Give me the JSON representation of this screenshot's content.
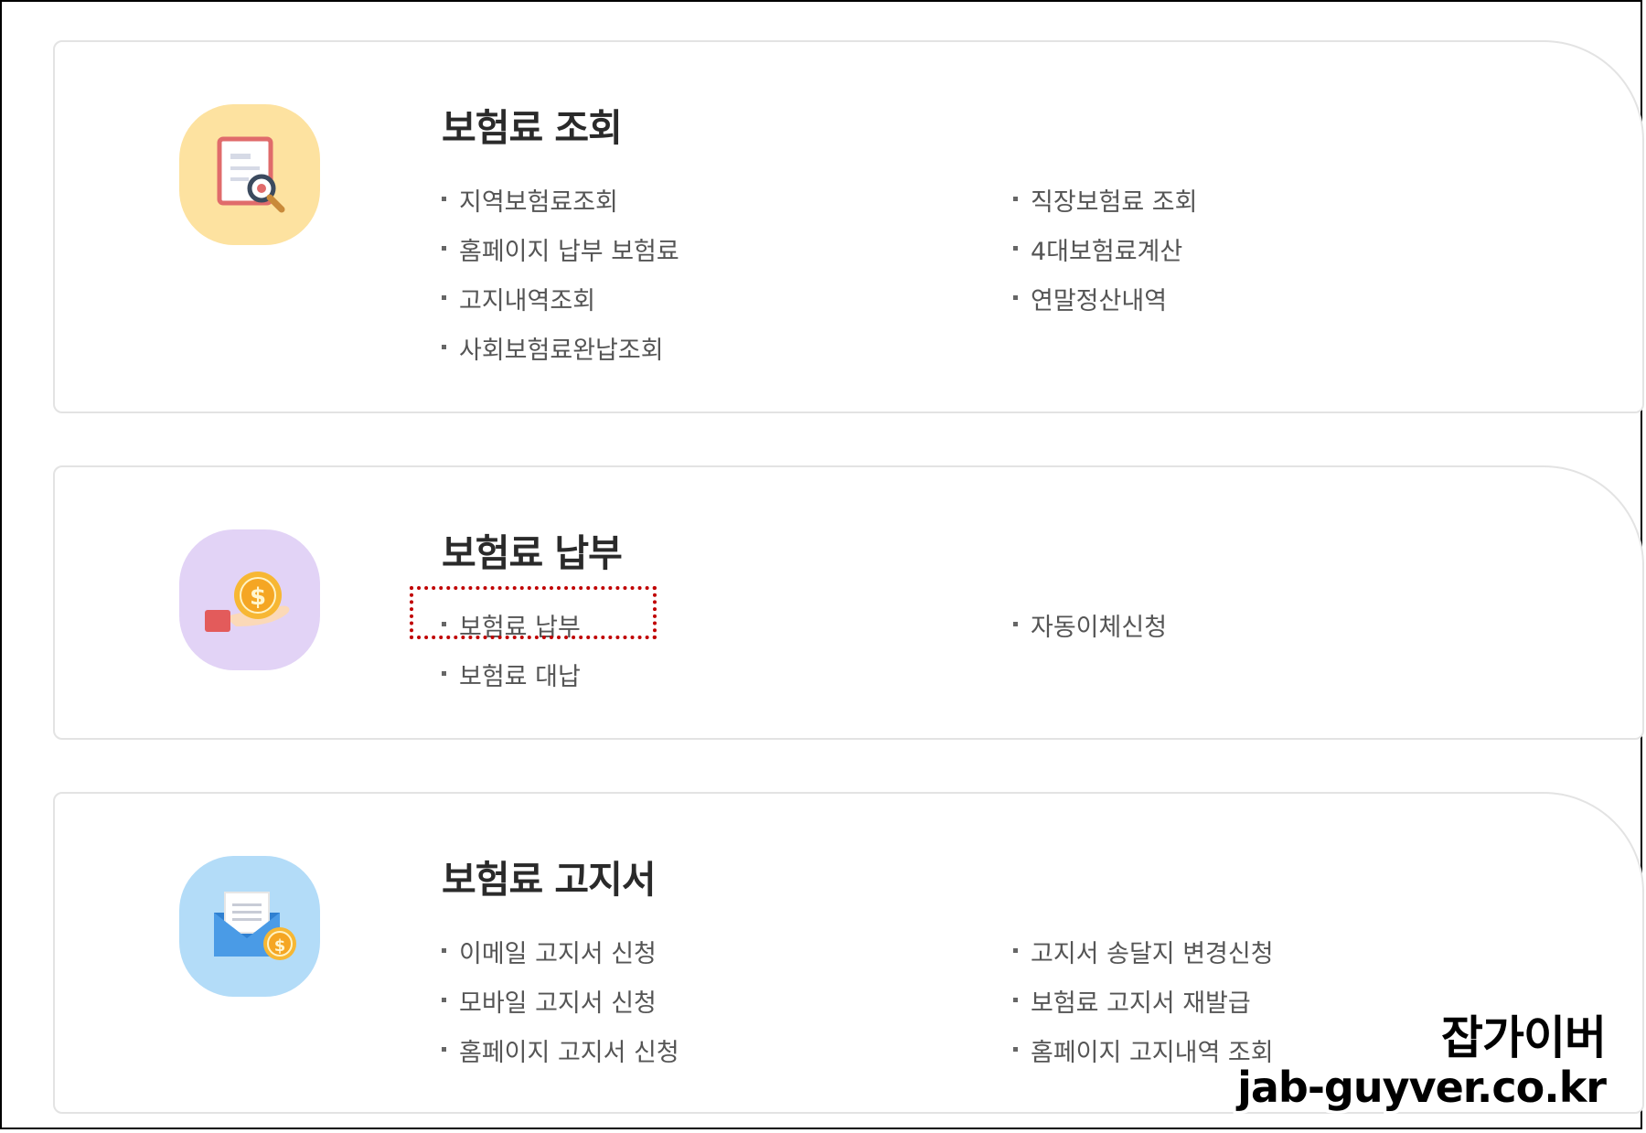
{
  "sections": [
    {
      "title": "보험료 조회",
      "icon": "document-search-icon",
      "icon_bg": "#fde2a0",
      "left_links": [
        "지역보험료조회",
        "홈페이지 납부 보험료",
        "고지내역조회",
        "사회보험료완납조회"
      ],
      "right_links": [
        "직장보험료 조회",
        "4대보험료계산",
        "연말정산내역"
      ]
    },
    {
      "title": "보험료 납부",
      "icon": "coin-hand-icon",
      "icon_bg": "#e2d3f6",
      "left_links": [
        "보험료 납부",
        "보험료 대납"
      ],
      "right_links": [
        "자동이체신청"
      ]
    },
    {
      "title": "보험료 고지서",
      "icon": "envelope-coin-icon",
      "icon_bg": "#b3dcf8",
      "left_links": [
        "이메일 고지서 신청",
        "모바일 고지서 신청",
        "홈페이지 고지서 신청"
      ],
      "right_links": [
        "고지서 송달지 변경신청",
        "보험료 고지서 재발급",
        "홈페이지 고지내역 조회"
      ]
    }
  ],
  "highlight_color": "#c00000",
  "watermark": {
    "korean": "잡가이버",
    "url": "jab-guyver.co.kr"
  }
}
